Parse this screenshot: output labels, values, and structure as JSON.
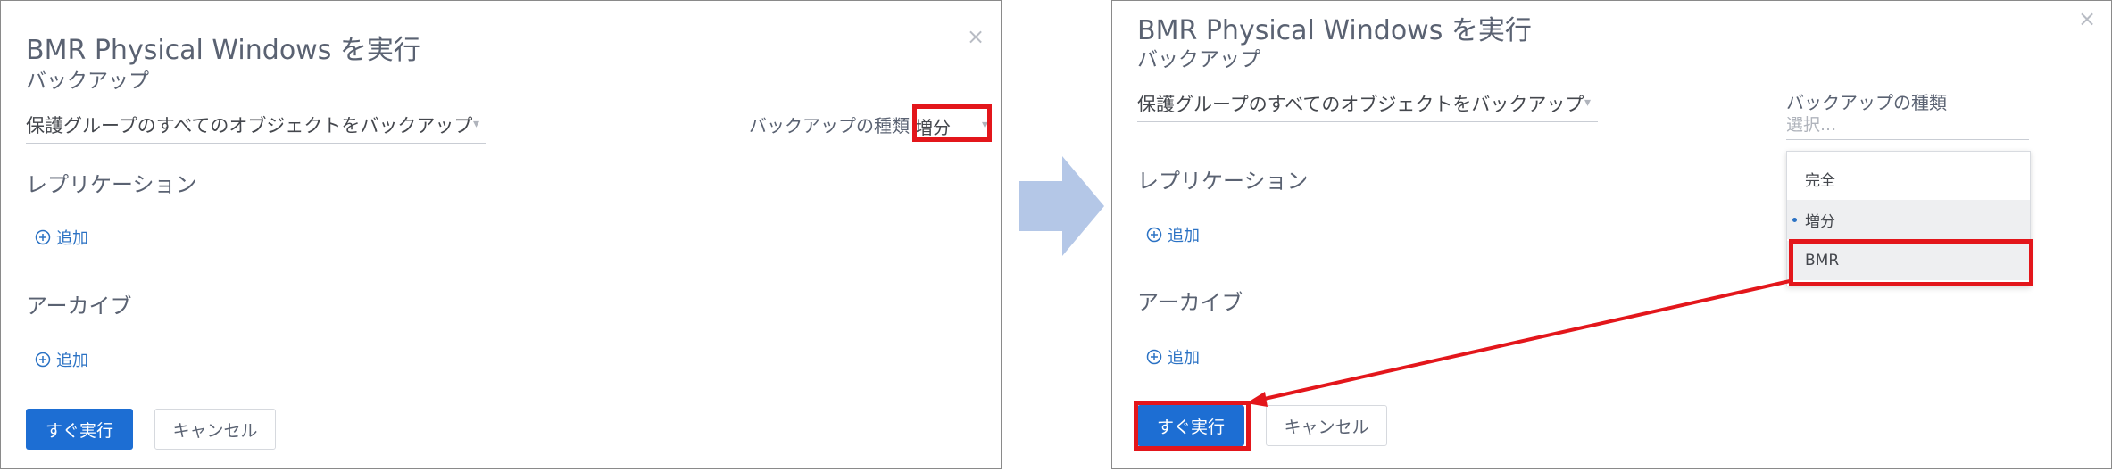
{
  "left_dialog": {
    "title": "BMR Physical Windows を実行",
    "subtitle": "バックアップ",
    "close_glyph": "×",
    "scope_select": "保護グループのすべてのオブジェクトをバックアップ",
    "backup_type_label": "バックアップの種類",
    "backup_type_value": "増分",
    "replication_heading": "レプリケーション",
    "replication_add": "追加",
    "archive_heading": "アーカイブ",
    "archive_add": "追加",
    "run_now_button": "すぐ実行",
    "cancel_button": "キャンセル"
  },
  "right_dialog": {
    "title": "BMR Physical Windows を実行",
    "subtitle": "バックアップ",
    "close_glyph": "×",
    "scope_select": "保護グループのすべてのオブジェクトをバックアップ",
    "backup_type_label": "バックアップの種類",
    "backup_type_placeholder": "選択...",
    "dropdown_options": [
      "完全",
      "増分",
      "BMR"
    ],
    "dropdown_selected": "増分",
    "replication_heading": "レプリケーション",
    "replication_add": "追加",
    "archive_heading": "アーカイブ",
    "archive_add": "追加",
    "run_now_button": "すぐ実行",
    "cancel_button": "キャンセル"
  },
  "colors": {
    "highlight": "#e3161b",
    "primary_button": "#1d6ed3",
    "link": "#2b72c4",
    "transition_arrow": "#b4c7e7"
  },
  "icons": [
    "close-icon",
    "plus-circle-icon",
    "chevron-down-icon",
    "transition-arrow-icon"
  ]
}
